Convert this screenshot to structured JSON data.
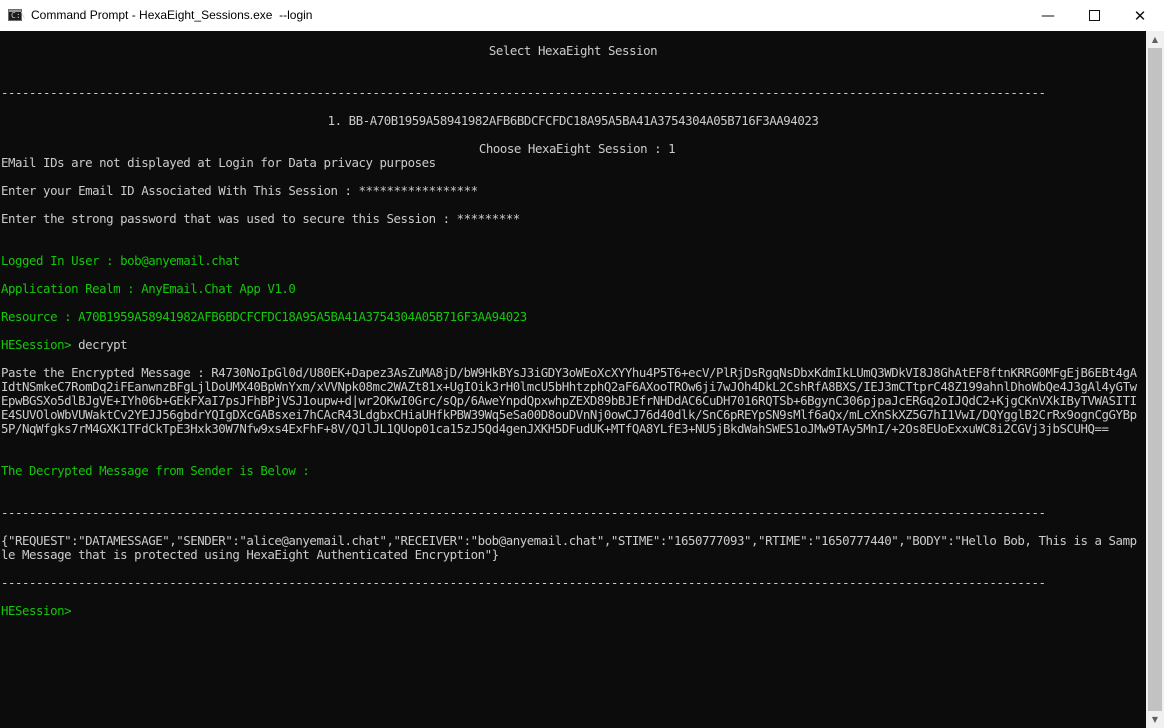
{
  "window": {
    "title": "Command Prompt - HexaEight_Sessions.exe  --login",
    "icon": "cmd-icon",
    "minimize_glyph": "—",
    "close_glyph": "✕"
  },
  "console": {
    "header": "Select HexaEight Session",
    "separator": "-----------------------------------------------------------------------------------------------------------------------------------------------------",
    "session_item": "1. BB-A70B1959A58941982AFB6BDCFCFDC18A95A5BA41A3754304A05B716F3AA94023",
    "choose_prompt": "Choose HexaEight Session : 1",
    "email_notice": "EMail IDs are not displayed at Login for Data privacy purposes",
    "email_prompt": "Enter your Email ID Associated With This Session : *****************",
    "password_prompt": "Enter the strong password that was used to secure this Session : *********",
    "logged_in": "Logged In User : bob@anyemail.chat",
    "realm": "Application Realm : AnyEmail.Chat App V1.0",
    "resource": "Resource : A70B1959A58941982AFB6BDCFCFDC18A95A5BA41A3754304A05B716F3AA94023",
    "command_line": "HESession> decrypt",
    "paste_prompt": "Paste the Encrypted Message : R4730NoIpGl0d/U80EK+Dapez3AsZuMA8jD/bW9HkBYsJ3iGDY3oWEoXcXYYhu4P5T6+ecV/PlRjDsRgqNsDbxKdmIkLUmQ3WDkVI8J8GhAtEF8ftnKRRG0MFgEjB6EBt4gAIdtNSmkeC7RomDq2iFEanwnzBFgLjlDoUMX40BpWnYxm/xVVNpk08mc2WAZt81x+UgIOik3rH0lmcU5bHhtzphQ2aF6AXooTROw6ji7wJOh4DkL2CshRfA8BXS/IEJ3mCTtprC48Z199ahnlDhoWbQe4J3gAl4yGTwEpwBGSXo5dlBJgVE+IYh06b+GEkFXaI7psJFhBPjVSJ1oupw+d|wr2OKwI0Grc/sQp/6AweYnpdQpxwhpZEXD89bBJEfrNHDdAC6CuDH7016RQTSb+6BgynC306pjpaJcERGq2oIJQdC2+KjgCKnVXkIByTVWASITIE4SUVOloWbVUWaktCv2YEJJ56gbdrYQIgDXcGABsxei7hCAcR43LdgbxCHiaUHfkPBW39Wq5eSa00D8ouDVnNj0owCJ76d40dlk/SnC6pREYpSN9sMlf6aQx/mLcXnSkXZ5G7hI1VwI/DQYgglB2CrRx9ognCgGYBp5P/NqWfgks7rM4GXK1TFdCkTpE3Hxk30W7Nfw9xs4ExFhF+8V/QJlJL1QUop01ca15zJ5Qd4genJXKH5DFudUK+MTfQA8YLfE3+NU5jBkdWahSWES1oJMw9TAy5MnI/+2Os8EUoExxuWC8i2CGVj3jbSCUHQ==",
    "decrypted_label": "The Decrypted Message from Sender is Below :",
    "decrypted_message": "{\"REQUEST\":\"DATAMESSAGE\",\"SENDER\":\"alice@anyemail.chat\",\"RECEIVER\":\"bob@anyemail.chat\",\"STIME\":\"1650777093\",\"RTIME\":\"1650777440\",\"BODY\":\"Hello Bob, This is a Sample Message that is protected using HexaEight Authenticated Encryption\"}",
    "final_prompt": "HESession>"
  },
  "colors": {
    "console_bg": "#0c0c0c",
    "console_text": "#cccccc",
    "green_text": "#16c60c"
  }
}
